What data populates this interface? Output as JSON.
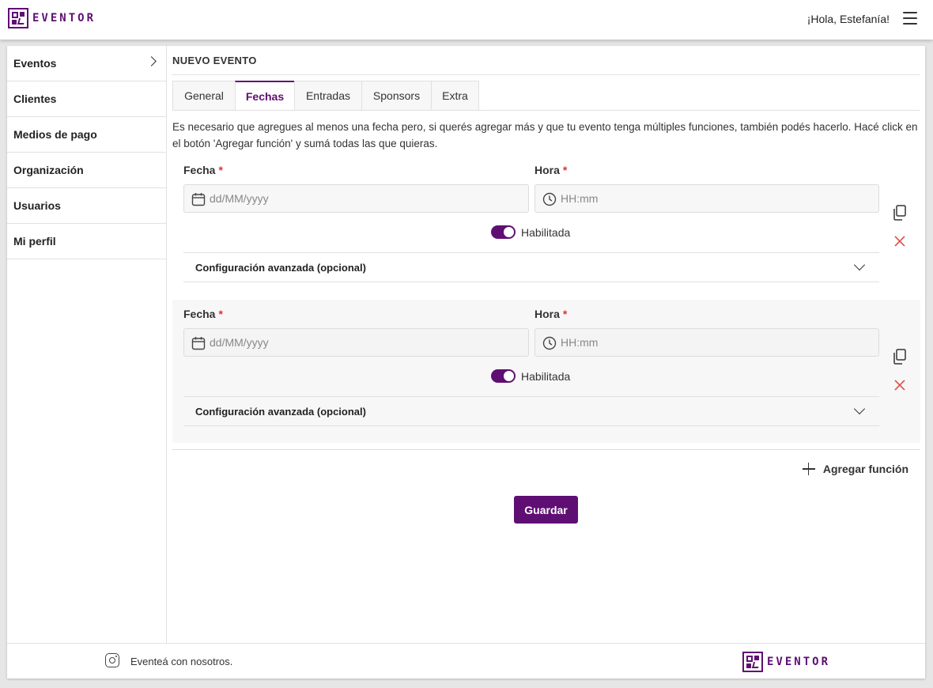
{
  "app": {
    "brand": "EVENTOR",
    "greeting": "¡Hola, Estefanía!"
  },
  "sidebar": {
    "items": [
      {
        "label": "Eventos"
      },
      {
        "label": "Clientes"
      },
      {
        "label": "Medios de pago"
      },
      {
        "label": "Organización"
      },
      {
        "label": "Usuarios"
      },
      {
        "label": "Mi perfil"
      }
    ]
  },
  "page": {
    "title": "NUEVO EVENTO",
    "tabs": [
      {
        "label": "General"
      },
      {
        "label": "Fechas"
      },
      {
        "label": "Entradas"
      },
      {
        "label": "Sponsors"
      },
      {
        "label": "Extra"
      }
    ],
    "active_tab": "Fechas",
    "description": "Es necesario que agregues al menos una fecha pero, si querés agregar más y que tu evento tenga múltiples funciones, también podés hacerlo. Hacé click en el botón 'Agregar función' y sumá todas las que quieras."
  },
  "functions": [
    {
      "date_label": "Fecha",
      "date_placeholder": "dd/MM/yyyy",
      "time_label": "Hora",
      "time_placeholder": "HH:mm",
      "required_mark": "*",
      "toggle_label": "Habilitada",
      "enabled": true,
      "advanced_label": "Configuración avanzada (opcional)"
    },
    {
      "date_label": "Fecha",
      "date_placeholder": "dd/MM/yyyy",
      "time_label": "Hora",
      "time_placeholder": "HH:mm",
      "required_mark": "*",
      "toggle_label": "Habilitada",
      "enabled": true,
      "advanced_label": "Configuración avanzada (opcional)"
    }
  ],
  "actions": {
    "add_function": "Agregar función",
    "save": "Guardar"
  },
  "footer": {
    "text": "Eventeá con nosotros.",
    "brand": "EVENTOR"
  },
  "colors": {
    "accent": "#5f0f73",
    "danger": "#d9534f"
  }
}
